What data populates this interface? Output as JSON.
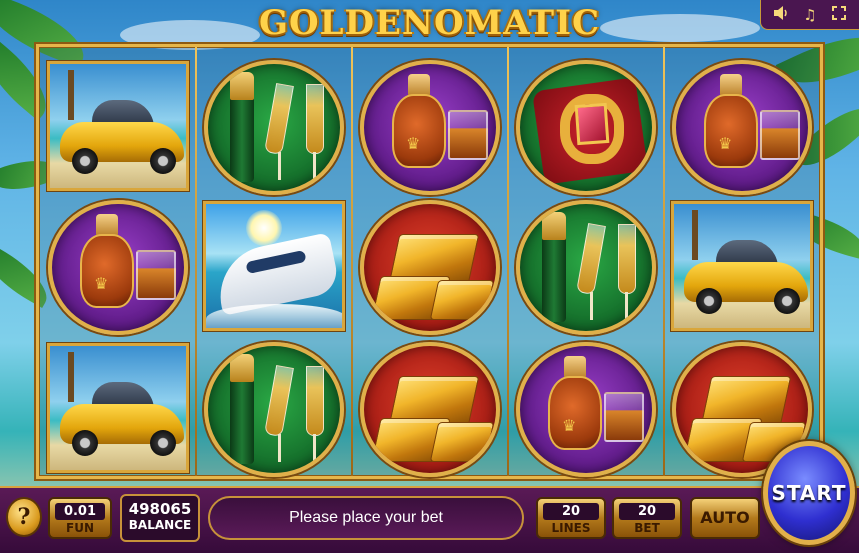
{
  "game": {
    "title": "GOLDENOMATIC"
  },
  "top_controls": {
    "volume_icon": "speaker-icon",
    "music_icon": "music-note-icon",
    "fullscreen_icon": "fullscreen-icon"
  },
  "reels": [
    [
      "car",
      "cognac",
      "car"
    ],
    [
      "champagne",
      "yacht",
      "champagne"
    ],
    [
      "cognac",
      "gold-bars",
      "gold-bars"
    ],
    [
      "ring",
      "champagne",
      "cognac"
    ],
    [
      "cognac",
      "car",
      "gold-bars"
    ]
  ],
  "bottom_bar": {
    "help_label": "?",
    "coin": {
      "value": "0.01",
      "label": "FUN"
    },
    "balance": {
      "value": "498065",
      "label": "BALANCE"
    },
    "message": "Please place your bet",
    "lines": {
      "value": "20",
      "label": "LINES"
    },
    "bet": {
      "value": "20",
      "label": "BET"
    },
    "auto_label": "AUTO",
    "start_label": "START"
  },
  "colors": {
    "gold": "#e6b64a",
    "panel_purple": "#4a1650",
    "start_blue": "#2f2fd0"
  }
}
